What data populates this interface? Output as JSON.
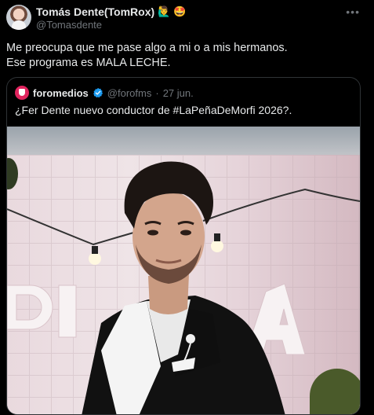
{
  "tweet": {
    "author_name": "Tomás Dente(TomRox)",
    "author_emojis": [
      "🙋‍♂️",
      "🤩"
    ],
    "handle": "@Tomasdente",
    "text_lines": [
      "Me preocupa que me pase algo a mi o a mis hermanos.",
      "Ese programa es MALA LECHE."
    ],
    "more_icon": "more-horizontal-icon"
  },
  "quote": {
    "author_name": "foromedios",
    "verified_icon": "verified-badge-icon",
    "handle": "@forofms",
    "separator": "·",
    "date": "27 jun.",
    "text": "¿Fer Dente nuevo conductor de #LaPeñaDeMorfi 2026?.",
    "image_description_icon": "photo"
  },
  "colors": {
    "background": "#000000",
    "text": "#e7e9ea",
    "secondary": "#71767b",
    "border": "#2f3336",
    "verified": "#1d9bf0",
    "logo": "#e0245e"
  }
}
